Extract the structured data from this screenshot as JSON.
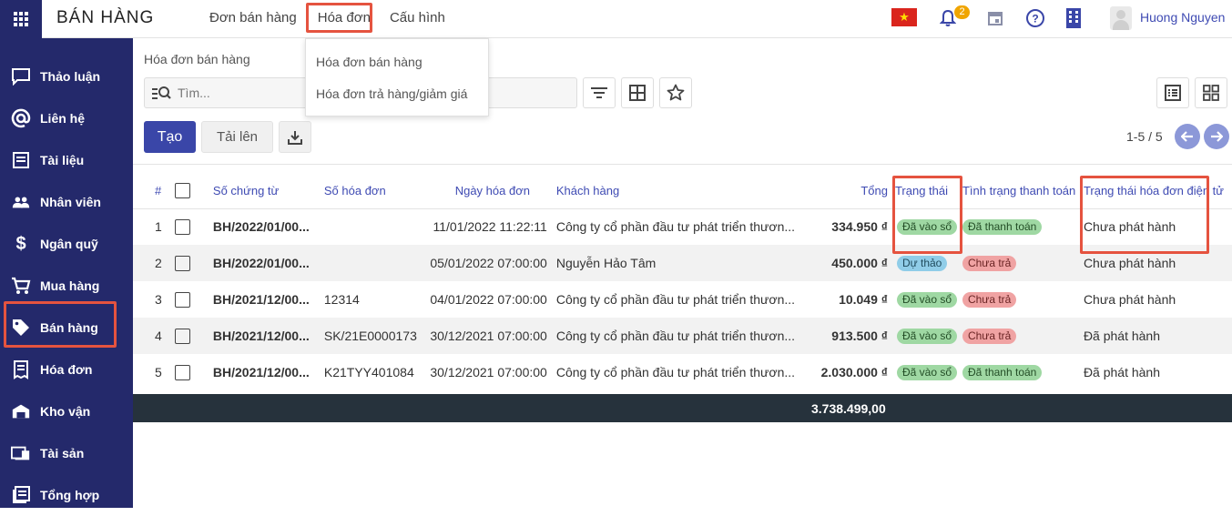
{
  "app": {
    "title": "BÁN HÀNG",
    "nav": [
      "Đơn bán hàng",
      "Hóa đơn",
      "Cấu hình"
    ],
    "notification_count": "2",
    "user_name": "Huong Nguyen"
  },
  "dropdown": {
    "items": [
      "Hóa đơn bán hàng",
      "Hóa đơn trả hàng/giảm giá"
    ]
  },
  "sidebar": {
    "items": [
      {
        "label": "Thảo luận",
        "icon": "chat-icon"
      },
      {
        "label": "Liên hệ",
        "icon": "at-icon"
      },
      {
        "label": "Tài liệu",
        "icon": "document-icon"
      },
      {
        "label": "Nhân viên",
        "icon": "people-icon"
      },
      {
        "label": "Ngân quỹ",
        "icon": "dollar-icon"
      },
      {
        "label": "Mua hàng",
        "icon": "cart-icon"
      },
      {
        "label": "Bán hàng",
        "icon": "tag-icon"
      },
      {
        "label": "Hóa đơn",
        "icon": "invoice-icon"
      },
      {
        "label": "Kho vận",
        "icon": "warehouse-icon"
      },
      {
        "label": "Tài sản",
        "icon": "asset-icon"
      },
      {
        "label": "Tổng hợp",
        "icon": "summary-icon"
      }
    ]
  },
  "control": {
    "breadcrumb": "Hóa đơn bán hàng",
    "search_placeholder": "Tìm...",
    "create_label": "Tạo",
    "upload_label": "Tải lên",
    "pager": "1-5 / 5"
  },
  "table": {
    "headers": {
      "index": "#",
      "doc_no": "Số chứng từ",
      "invoice_no": "Số hóa đơn",
      "date": "Ngày hóa đơn",
      "customer": "Khách hàng",
      "total": "Tổng",
      "status": "Trạng thái",
      "payment": "Tình trạng thanh toán",
      "einvoice": "Trạng thái hóa đơn điện tử"
    },
    "rows": [
      {
        "index": "1",
        "doc_no": "BH/2022/01/00...",
        "invoice_no": "",
        "date": "11/01/2022 11:22:11",
        "customer": "Công ty cổ phần đầu tư phát triển thươn...",
        "total": "334.950 ₫",
        "status": "Đã vào sổ",
        "status_color": "green",
        "payment": "Đã thanh toán",
        "payment_color": "green",
        "einvoice": "Chưa phát hành"
      },
      {
        "index": "2",
        "doc_no": "BH/2022/01/00...",
        "invoice_no": "",
        "date": "05/01/2022 07:00:00",
        "customer": "Nguyễn Hảo Tâm",
        "total": "450.000 ₫",
        "status": "Dự thảo",
        "status_color": "blue",
        "payment": "Chưa trả",
        "payment_color": "red",
        "einvoice": "Chưa phát hành"
      },
      {
        "index": "3",
        "doc_no": "BH/2021/12/00...",
        "invoice_no": "12314",
        "date": "04/01/2022 07:00:00",
        "customer": "Công ty cổ phần đầu tư phát triển thươn...",
        "total": "10.049 ₫",
        "status": "Đã vào sổ",
        "status_color": "green",
        "payment": "Chưa trả",
        "payment_color": "red",
        "einvoice": "Chưa phát hành"
      },
      {
        "index": "4",
        "doc_no": "BH/2021/12/00...",
        "invoice_no": "SK/21E0000173",
        "date": "30/12/2021 07:00:00",
        "customer": "Công ty cổ phần đầu tư phát triển thươn...",
        "total": "913.500 ₫",
        "status": "Đã vào sổ",
        "status_color": "green",
        "payment": "Chưa trả",
        "payment_color": "red",
        "einvoice": "Đã phát hành"
      },
      {
        "index": "5",
        "doc_no": "BH/2021/12/00...",
        "invoice_no": "K21TYY401084",
        "date": "30/12/2021 07:00:00",
        "customer": "Công ty cổ phần đầu tư phát triển thươn...",
        "total": "2.030.000 ₫",
        "status": "Đã vào sổ",
        "status_color": "green",
        "payment": "Đã thanh toán",
        "payment_color": "green",
        "einvoice": "Đã phát hành"
      }
    ],
    "footer_total": "3.738.499,00"
  },
  "colors": {
    "sidebar_bg": "#24296b",
    "primary": "#3a46a8",
    "highlight_box": "#e5533f",
    "footer_bg": "#26323c"
  }
}
